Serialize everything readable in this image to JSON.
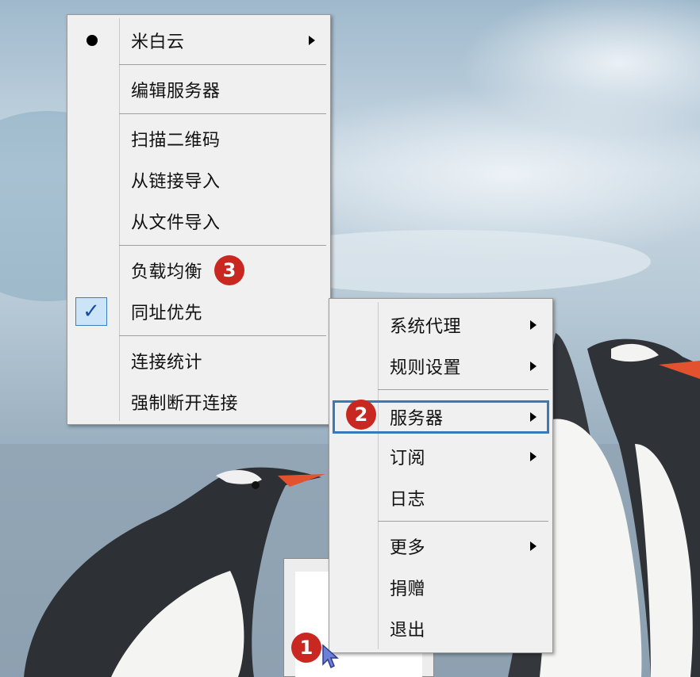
{
  "menu_main": {
    "items": [
      {
        "label": "米白云",
        "radio": true,
        "submenu": true
      },
      {
        "label": "编辑服务器"
      },
      {
        "label": "扫描二维码"
      },
      {
        "label": "从链接导入"
      },
      {
        "label": "从文件导入"
      },
      {
        "label": "负载均衡"
      },
      {
        "label": "同址优先",
        "checked": true,
        "check_glyph": "✓"
      },
      {
        "label": "连接统计"
      },
      {
        "label": "强制断开连接"
      }
    ]
  },
  "menu_tray": {
    "items": [
      {
        "label": "系统代理",
        "submenu": true
      },
      {
        "label": "规则设置",
        "submenu": true
      },
      {
        "label": "服务器",
        "submenu": true,
        "highlighted": true
      },
      {
        "label": "订阅",
        "submenu": true
      },
      {
        "label": "日志"
      },
      {
        "label": "更多",
        "submenu": true
      },
      {
        "label": "捐赠"
      },
      {
        "label": "退出"
      }
    ]
  },
  "annotations": {
    "badge_1": "1",
    "badge_2": "2",
    "badge_3": "3"
  },
  "colors": {
    "menu_bg": "#f0f0f0",
    "highlight_border": "#3a79b5",
    "badge": "#c8281f",
    "check_bg": "#cce4f7"
  }
}
